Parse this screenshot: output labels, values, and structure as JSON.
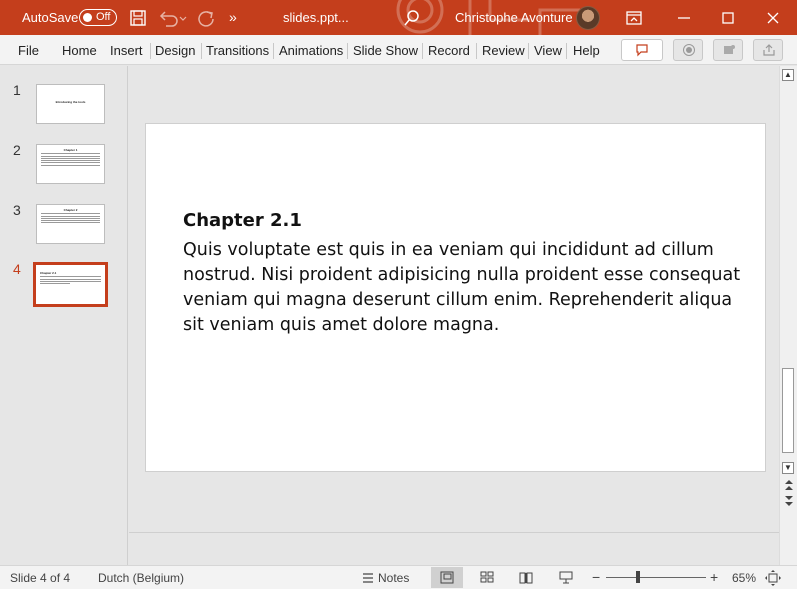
{
  "titlebar": {
    "autosave_label": "AutoSave",
    "autosave_state": "Off",
    "filename": "slides.ppt...",
    "username": "Christophe Avonture",
    "more_glyph": "»"
  },
  "ribbon": {
    "tabs": [
      "File",
      "Home",
      "Insert",
      "Design",
      "Transitions",
      "Animations",
      "Slide Show",
      "Record",
      "Review",
      "View",
      "Help"
    ]
  },
  "thumbnails": {
    "numbers": [
      "1",
      "2",
      "3",
      "4"
    ],
    "titles": [
      "Introducing the tools",
      "Chapter 1",
      "Chapter 2",
      "Chapter 2.1"
    ],
    "active_index": 4
  },
  "slide": {
    "title": "Chapter 2.1",
    "body": "Quis voluptate est quis in ea veniam qui incididunt ad cillum nostrud. Nisi proident adipisicing nulla proident esse consequat veniam qui magna deserunt cillum enim. Reprehenderit aliqua sit veniam quis amet dolore magna."
  },
  "statusbar": {
    "slide_info": "Slide 4 of 4",
    "language": "Dutch (Belgium)",
    "notes_label": "Notes",
    "zoom_minus": "−",
    "zoom_plus": "+",
    "zoom_level": "65%"
  },
  "colors": {
    "accent": "#c43e1c",
    "chrome": "#f3f3f3",
    "workspace": "#e6e6e6"
  }
}
